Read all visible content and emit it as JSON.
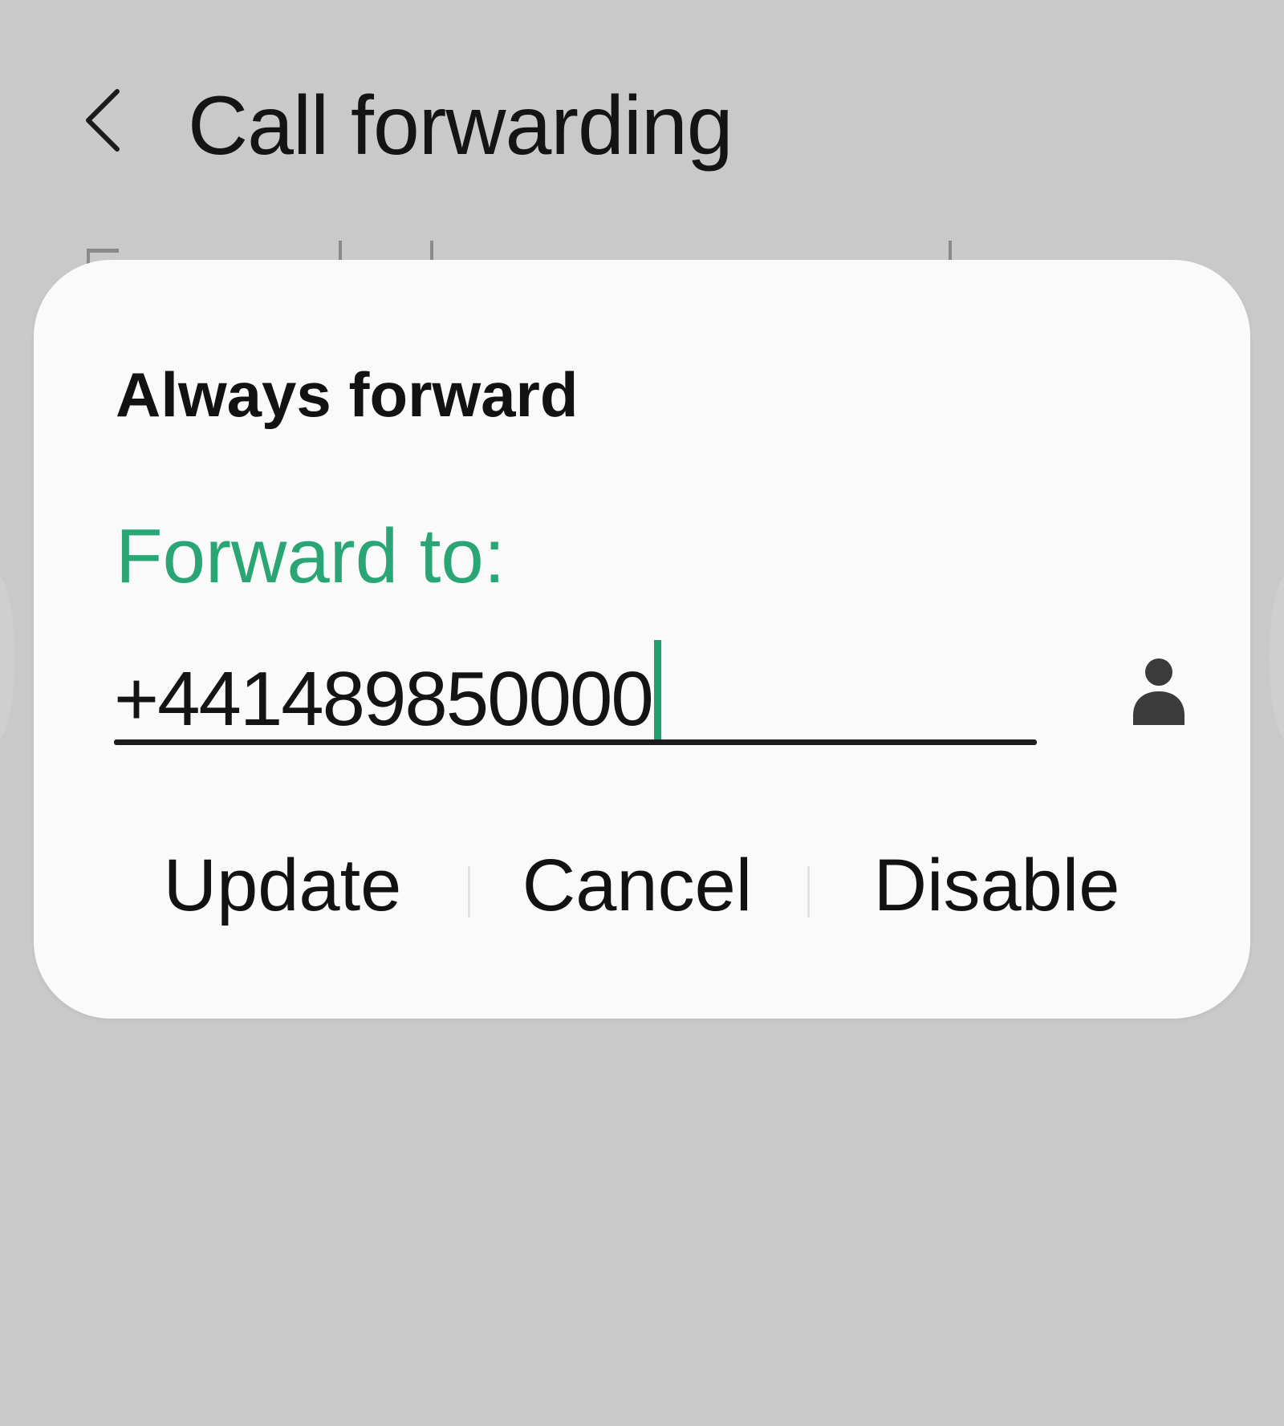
{
  "header": {
    "title": "Call forwarding",
    "back_icon": "chevron-left-icon"
  },
  "dialog": {
    "title": "Always forward",
    "field_label": "Forward to:",
    "field_value": "+441489850000",
    "contact_icon": "person-icon",
    "buttons": {
      "update": "Update",
      "cancel": "Cancel",
      "disable": "Disable"
    }
  },
  "colors": {
    "background": "#c9c9c9",
    "dialog": "#fafafa",
    "accent": "#2aa676",
    "text": "#141414"
  }
}
